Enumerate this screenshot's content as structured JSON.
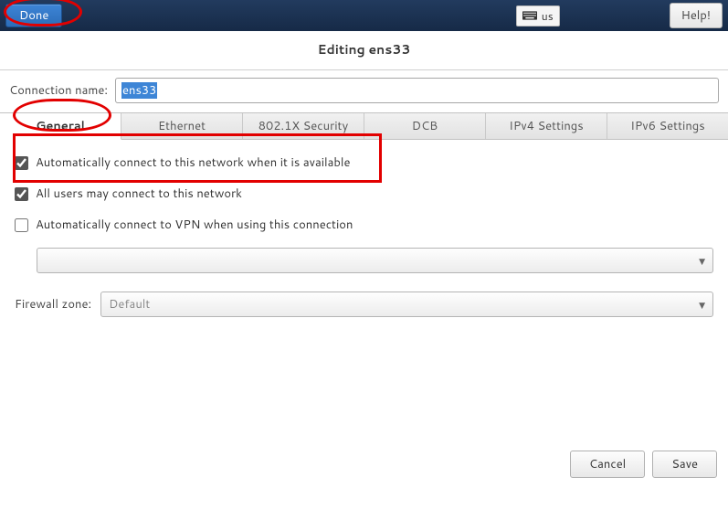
{
  "topbar": {
    "done_label": "Done",
    "kbd_layout": "us",
    "help_label": "Help!"
  },
  "dialog": {
    "title": "Editing ens33",
    "connection_name_label": "Connection name:",
    "connection_name_value": "ens33"
  },
  "tabs": [
    {
      "id": "general",
      "label": "General",
      "active": true
    },
    {
      "id": "ethernet",
      "label": "Ethernet",
      "active": false
    },
    {
      "id": "8021x",
      "label": "802.1X Security",
      "active": false
    },
    {
      "id": "dcb",
      "label": "DCB",
      "active": false
    },
    {
      "id": "ipv4",
      "label": "IPv4 Settings",
      "active": false
    },
    {
      "id": "ipv6",
      "label": "IPv6 Settings",
      "active": false
    }
  ],
  "general": {
    "auto_connect": {
      "label": "Automatically connect to this network when it is available",
      "checked": true
    },
    "all_users": {
      "label": "All users may connect to this network",
      "checked": true
    },
    "vpn_auto": {
      "label": "Automatically connect to VPN when using this connection",
      "checked": false
    },
    "vpn_selection": "",
    "firewall_label": "Firewall zone:",
    "firewall_value": "Default"
  },
  "footer": {
    "cancel_label": "Cancel",
    "save_label": "Save"
  }
}
